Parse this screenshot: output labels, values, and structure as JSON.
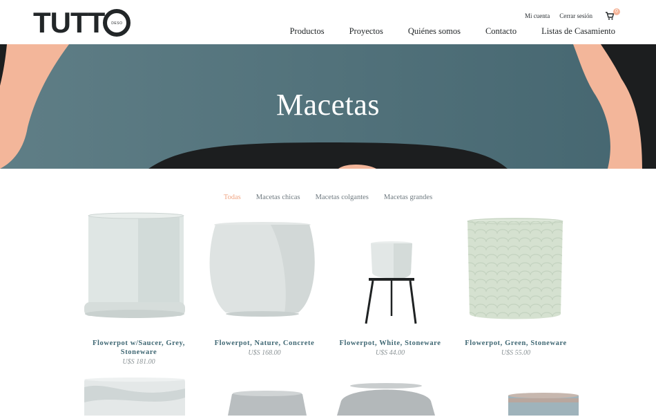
{
  "brand": {
    "logo_text": "TUTT",
    "logo_sub": "DESO"
  },
  "util": {
    "account": "Mi cuenta",
    "logout": "Cerrar sesión",
    "cart_count": "0"
  },
  "nav": [
    "Productos",
    "Proyectos",
    "Quiénes somos",
    "Contacto",
    "Listas de Casamiento"
  ],
  "hero": {
    "title": "Macetas"
  },
  "filters": {
    "active": "Todas",
    "items": [
      "Macetas chicas",
      "Macetas colgantes",
      "Macetas grandes"
    ]
  },
  "products": [
    {
      "name": "Flowerpot w/Saucer, Grey, Stoneware",
      "price": "U$S 181.00"
    },
    {
      "name": "Flowerpot, Nature, Concrete",
      "price": "U$S 168.00"
    },
    {
      "name": "Flowerpot, White, Stoneware",
      "price": "U$S 44.00"
    },
    {
      "name": "Flowerpot, Green, Stoneware",
      "price": "U$S 55.00"
    }
  ],
  "colors": {
    "accent": "#f0a583",
    "teal": "#4d6b72",
    "peach": "#f4b79a",
    "product_text": "#3f6773"
  }
}
